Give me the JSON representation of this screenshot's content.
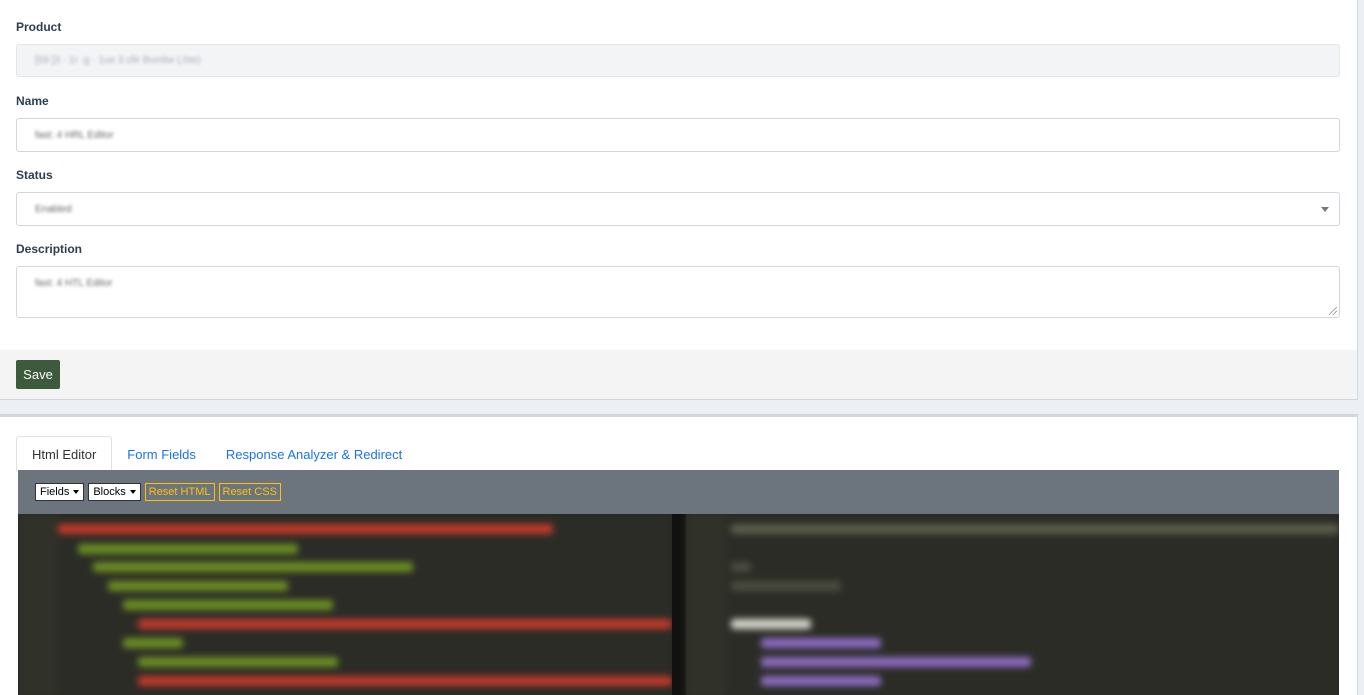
{
  "form": {
    "product_label": "Product",
    "product_value": "[59 ]3 · 1r ·g · 1ue 3 ufe Bumbe (.hte)",
    "name_label": "Name",
    "name_value": "fast: 4 HRL Editor",
    "status_label": "Status",
    "status_value": "Enabled",
    "description_label": "Description",
    "description_value": "fast: 4 HTL Editor",
    "save_label": "Save"
  },
  "tabs": [
    {
      "label": "Html Editor",
      "active": true
    },
    {
      "label": "Form Fields",
      "active": false
    },
    {
      "label": "Response Analyzer & Redirect",
      "active": false
    }
  ],
  "toolbar": {
    "fields_label": "Fields",
    "blocks_label": "Blocks",
    "reset_html_label": "Reset HTML",
    "reset_css_label": "Reset CSS"
  },
  "colors": {
    "save_button": "#3d5a3d",
    "tab_link": "#1a73e8",
    "toolbar_bg": "#6c757d",
    "toolbar_accent": "#ffc107",
    "editor_bg": "#272822"
  }
}
